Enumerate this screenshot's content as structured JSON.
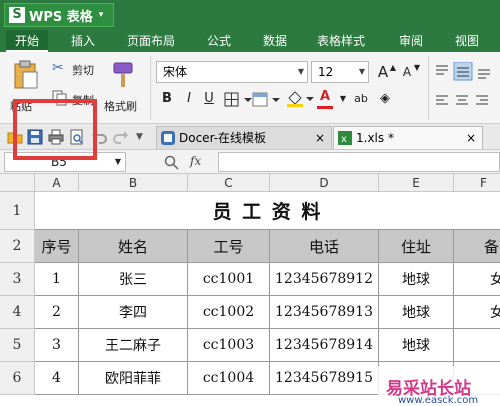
{
  "app": {
    "logo": "S",
    "title": "WPS 表格",
    "arrow": "▾"
  },
  "ribbon_tabs": [
    "开始",
    "插入",
    "页面布局",
    "公式",
    "数据",
    "表格样式",
    "审阅",
    "视图"
  ],
  "clipboard": {
    "paste": "粘贴",
    "cut": "剪切",
    "copy": "复制",
    "format_painter": "格式刷"
  },
  "font": {
    "family": "宋体",
    "size": "12",
    "grow": "A",
    "shrink": "A"
  },
  "format_buttons": [
    "B",
    "I",
    "U"
  ],
  "doc_tabs": [
    {
      "label": "Docer-在线模板",
      "close": "×"
    },
    {
      "label": "1.xls *",
      "close": "×"
    }
  ],
  "formula_bar": {
    "name_box": "B5",
    "fx": "fx"
  },
  "columns": [
    "A",
    "B",
    "C",
    "D",
    "E",
    "F"
  ],
  "rows": [
    "1",
    "2",
    "3",
    "4",
    "5",
    "6"
  ],
  "sheet": {
    "title": "员 工 资 料",
    "headers": [
      "序号",
      "姓名",
      "工号",
      "电话",
      "住址",
      "备"
    ],
    "records": [
      [
        "1",
        "张三",
        "cc1001",
        "12345678912",
        "地球",
        "女"
      ],
      [
        "2",
        "李四",
        "cc1002",
        "12345678913",
        "地球",
        "女"
      ],
      [
        "3",
        "王二麻子",
        "cc1003",
        "12345678914",
        "地球",
        ""
      ],
      [
        "4",
        "欧阳菲菲",
        "cc1004",
        "12345678915",
        "",
        ""
      ]
    ]
  },
  "watermark": {
    "line1": "易采站长站",
    "line2": "www.easck.com"
  },
  "colors": {
    "title_bar": "#2c7a3f",
    "highlight": "#e23b3b",
    "header_fill": "#c7c7c7"
  }
}
